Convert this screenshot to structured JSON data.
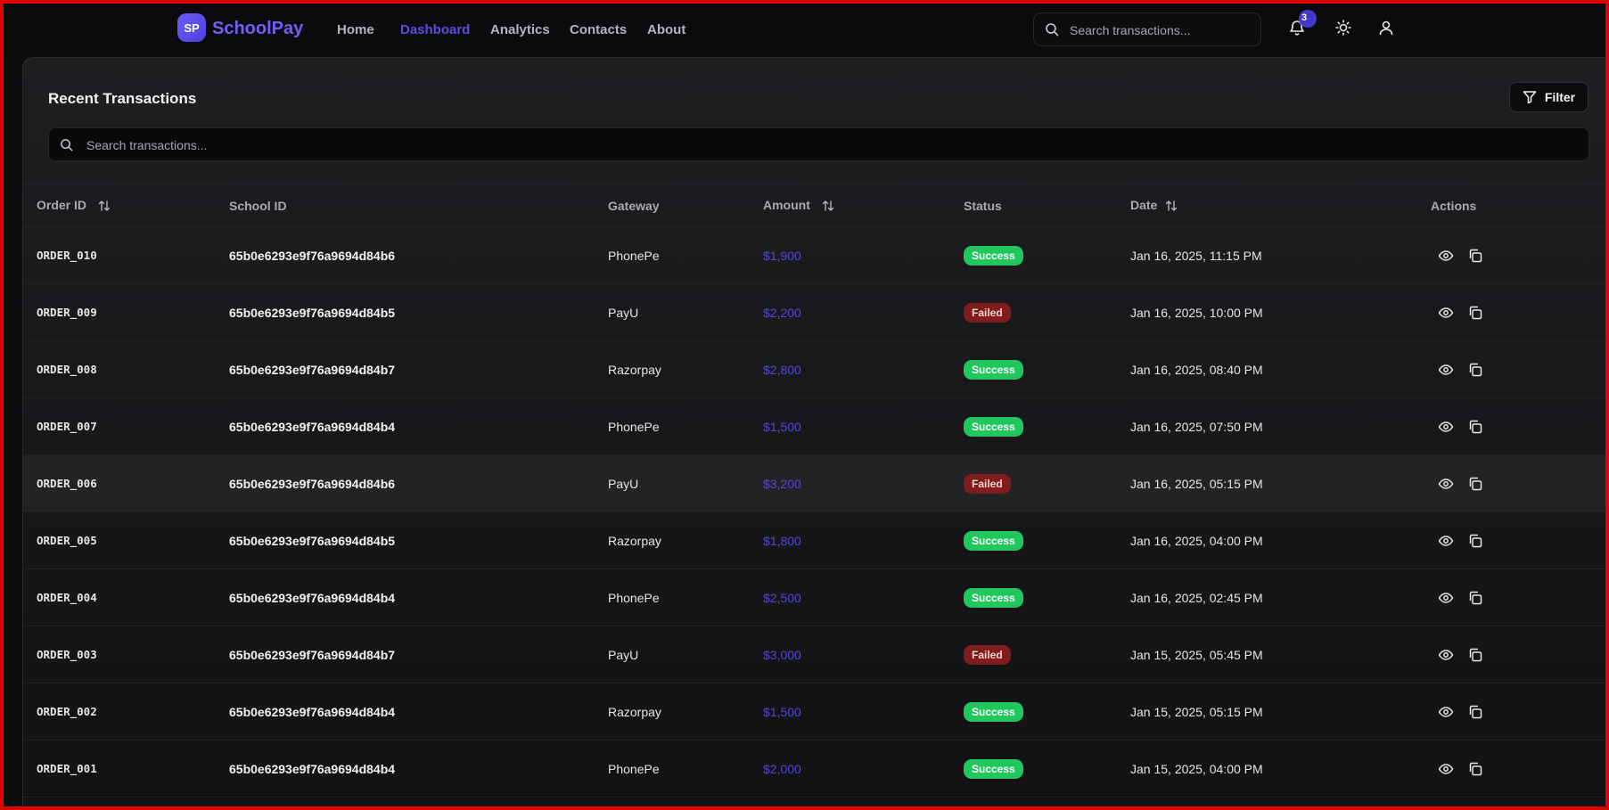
{
  "app": {
    "name": "SchoolPay",
    "logo_initials": "SP",
    "accent_color": "#5a4de6"
  },
  "nav": {
    "links": [
      {
        "label": "Home",
        "active": false
      },
      {
        "label": "Dashboard",
        "active": true
      },
      {
        "label": "Analytics",
        "active": false
      },
      {
        "label": "Contacts",
        "active": false
      },
      {
        "label": "About",
        "active": false
      }
    ],
    "search_placeholder": "Search transactions...",
    "notification_count": "3",
    "icons": [
      "bell-icon",
      "sun-icon",
      "user-icon"
    ]
  },
  "card": {
    "title": "Recent Transactions",
    "filter_label": "Filter",
    "search_placeholder": "Search transactions..."
  },
  "table": {
    "columns": [
      {
        "label": "Order ID",
        "sortable": true
      },
      {
        "label": "School ID",
        "sortable": false
      },
      {
        "label": "Gateway",
        "sortable": false
      },
      {
        "label": "Amount",
        "sortable": true
      },
      {
        "label": "Status",
        "sortable": false
      },
      {
        "label": "Date",
        "sortable": true
      },
      {
        "label": "Actions",
        "sortable": false
      }
    ],
    "rows": [
      {
        "order_id": "ORDER_010",
        "school_id": "65b0e6293e9f76a9694d84b6",
        "gateway": "PhonePe",
        "amount": "$1,900",
        "status": "Success",
        "date": "Jan 16, 2025, 11:15 PM"
      },
      {
        "order_id": "ORDER_009",
        "school_id": "65b0e6293e9f76a9694d84b5",
        "gateway": "PayU",
        "amount": "$2,200",
        "status": "Failed",
        "date": "Jan 16, 2025, 10:00 PM"
      },
      {
        "order_id": "ORDER_008",
        "school_id": "65b0e6293e9f76a9694d84b7",
        "gateway": "Razorpay",
        "amount": "$2,800",
        "status": "Success",
        "date": "Jan 16, 2025, 08:40 PM"
      },
      {
        "order_id": "ORDER_007",
        "school_id": "65b0e6293e9f76a9694d84b4",
        "gateway": "PhonePe",
        "amount": "$1,500",
        "status": "Success",
        "date": "Jan 16, 2025, 07:50 PM"
      },
      {
        "order_id": "ORDER_006",
        "school_id": "65b0e6293e9f76a9694d84b6",
        "gateway": "PayU",
        "amount": "$3,200",
        "status": "Failed",
        "date": "Jan 16, 2025, 05:15 PM"
      },
      {
        "order_id": "ORDER_005",
        "school_id": "65b0e6293e9f76a9694d84b5",
        "gateway": "Razorpay",
        "amount": "$1,800",
        "status": "Success",
        "date": "Jan 16, 2025, 04:00 PM"
      },
      {
        "order_id": "ORDER_004",
        "school_id": "65b0e6293e9f76a9694d84b4",
        "gateway": "PhonePe",
        "amount": "$2,500",
        "status": "Success",
        "date": "Jan 16, 2025, 02:45 PM"
      },
      {
        "order_id": "ORDER_003",
        "school_id": "65b0e6293e9f76a9694d84b7",
        "gateway": "PayU",
        "amount": "$3,000",
        "status": "Failed",
        "date": "Jan 15, 2025, 05:45 PM"
      },
      {
        "order_id": "ORDER_002",
        "school_id": "65b0e6293e9f76a9694d84b4",
        "gateway": "Razorpay",
        "amount": "$1,500",
        "status": "Success",
        "date": "Jan 15, 2025, 05:15 PM"
      },
      {
        "order_id": "ORDER_001",
        "school_id": "65b0e6293e9f76a9694d84b4",
        "gateway": "PhonePe",
        "amount": "$2,000",
        "status": "Success",
        "date": "Jan 15, 2025, 04:00 PM"
      }
    ],
    "row_action_icons": [
      "eye-icon",
      "copy-icon"
    ],
    "status_colors": {
      "Success": "#22c55e",
      "Failed": "#7f1d1d"
    },
    "amount_color": "#4f46e5"
  }
}
